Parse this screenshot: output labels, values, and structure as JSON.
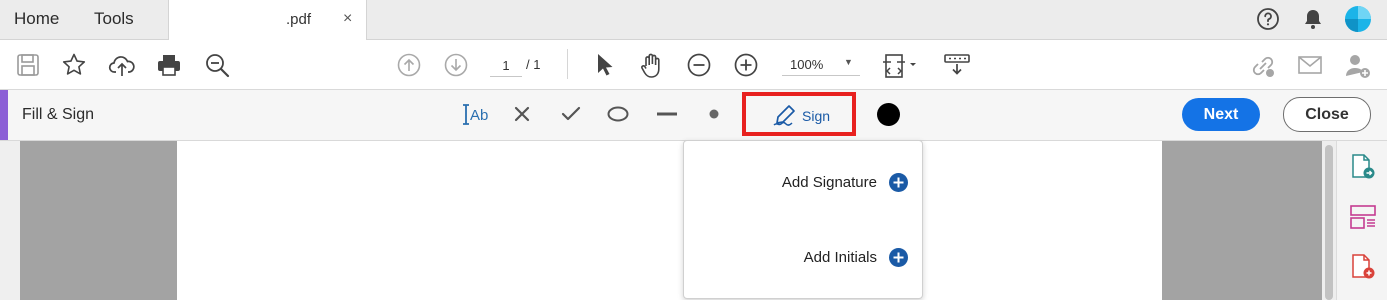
{
  "menu": {
    "home": "Home",
    "tools": "Tools"
  },
  "document_tab": {
    "title": ".pdf",
    "close": "×"
  },
  "toolbar": {
    "page_current": "1",
    "page_total": "/ 1",
    "zoom": "100%"
  },
  "fill_sign": {
    "title": "Fill & Sign",
    "sign_label": "Sign",
    "next_label": "Next",
    "close_label": "Close",
    "ink_color": "#000000"
  },
  "sign_menu": {
    "items": [
      {
        "label": "Add Signature",
        "icon": "add-circle-icon"
      },
      {
        "label": "Add Initials",
        "icon": "add-circle-icon"
      }
    ]
  },
  "colors": {
    "accent_purple": "#8c5fd6",
    "primary_blue": "#1473e6",
    "highlight_red": "#e8211f"
  }
}
